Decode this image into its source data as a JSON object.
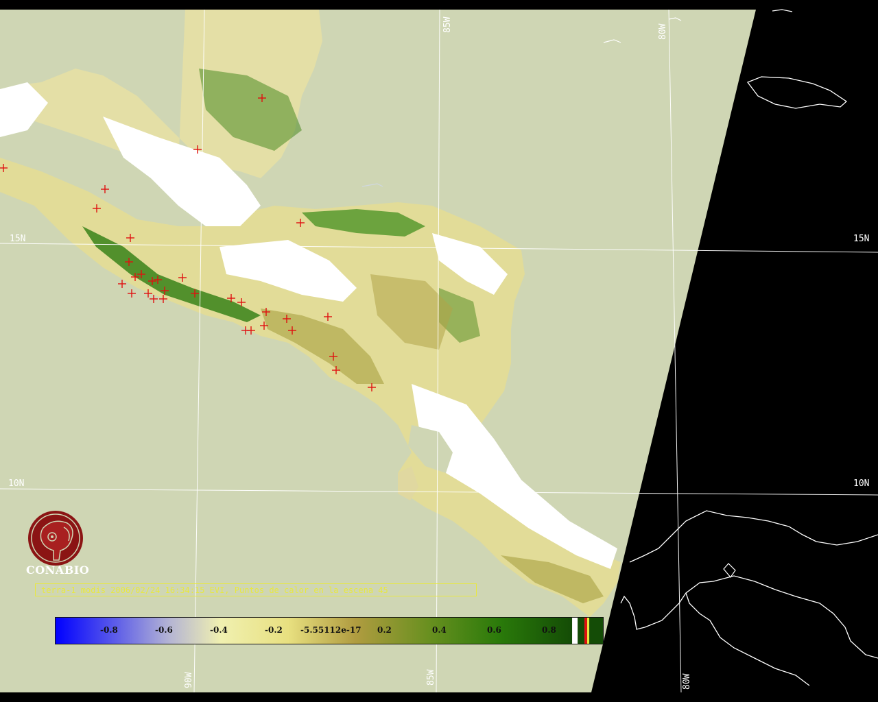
{
  "grid_labels": {
    "lon_top_85w": "85W",
    "lon_top_80w": "80W",
    "lon_bottom_90w": "90W",
    "lon_bottom_85w": "85W",
    "lon_bottom_80w": "80W",
    "lat_left_15n": "15N",
    "lat_right_15n": "15N",
    "lat_left_10n": "10N",
    "lat_right_10n": "10N"
  },
  "logo": {
    "text": "CONABIO",
    "icon": "conabio-macaw-logo-icon",
    "color": "#8b1414"
  },
  "caption": "terra-1 modis 2006/02/24 16:34:15 EVI, Puntos de calor en la escena 45",
  "colorbar": {
    "ticks": [
      "-0.8",
      "-0.6",
      "-0.4",
      "-0.2",
      "-5.55112e-17",
      "0.2",
      "0.4",
      "0.6",
      "0.8"
    ],
    "stops": [
      "#0000ff",
      "#b4b4d4",
      "#f0f0b0",
      "#e8e080",
      "#b09c40",
      "#6a9020",
      "#2a7a0a",
      "#144c06"
    ],
    "caption_color": "#e8e840"
  },
  "colors": {
    "ocean": "#cfd6b4",
    "outside_swath": "#000000",
    "cloud": "#ffffff",
    "hotspot": "#e01010",
    "vegetation_dark": "#2e7d12",
    "vegetation_mid": "#a8a040",
    "vegetation_light": "#e2dc98"
  },
  "hotspots": [
    [
      5,
      245
    ],
    [
      153,
      276
    ],
    [
      141,
      304
    ],
    [
      190,
      347
    ],
    [
      188,
      382
    ],
    [
      178,
      414
    ],
    [
      197,
      404
    ],
    [
      206,
      400
    ],
    [
      222,
      410
    ],
    [
      230,
      408
    ],
    [
      192,
      428
    ],
    [
      216,
      428
    ],
    [
      224,
      436
    ],
    [
      238,
      436
    ],
    [
      240,
      424
    ],
    [
      266,
      405
    ],
    [
      284,
      428
    ],
    [
      337,
      435
    ],
    [
      352,
      441
    ],
    [
      358,
      482
    ],
    [
      366,
      482
    ],
    [
      388,
      455
    ],
    [
      385,
      475
    ],
    [
      418,
      465
    ],
    [
      426,
      482
    ],
    [
      478,
      462
    ],
    [
      486,
      520
    ],
    [
      490,
      540
    ],
    [
      542,
      565
    ],
    [
      438,
      325
    ],
    [
      288,
      218
    ],
    [
      382,
      143
    ]
  ]
}
